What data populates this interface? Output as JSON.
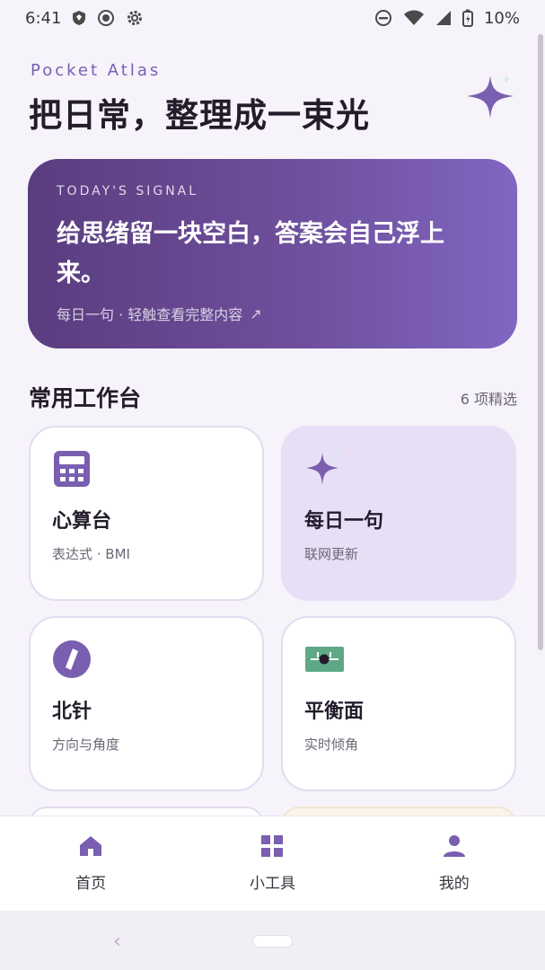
{
  "status_bar": {
    "time": "6:41",
    "battery": "10%",
    "left_icons": [
      "shield-icon",
      "record-icon",
      "gear-icon"
    ],
    "right_icons": [
      "dnd-icon",
      "wifi-icon",
      "signal-icon",
      "battery-icon"
    ]
  },
  "header": {
    "brand": "Pocket Atlas",
    "headline": "把日常，整理成一束光"
  },
  "signal_card": {
    "eyebrow": "TODAY'S SIGNAL",
    "quote": "给思绪留一块空白，答案会自己浮上来。",
    "meta": "每日一句 · 轻触查看完整内容",
    "arrow": "↗"
  },
  "section": {
    "title": "常用工作台",
    "count": "6 项精选"
  },
  "tools": [
    {
      "name": "心算台",
      "desc": "表达式 · BMI",
      "icon": "calculator-icon"
    },
    {
      "name": "每日一句",
      "desc": "联网更新",
      "icon": "sparkle-icon"
    },
    {
      "name": "北针",
      "desc": "方向与角度",
      "icon": "compass-icon"
    },
    {
      "name": "平衡面",
      "desc": "实时倾角",
      "icon": "level-icon"
    }
  ],
  "bottom_nav": [
    {
      "label": "首页",
      "icon": "home-icon"
    },
    {
      "label": "小工具",
      "icon": "grid-icon"
    },
    {
      "label": "我的",
      "icon": "person-icon"
    }
  ],
  "colors": {
    "accent": "#7a5fb0",
    "card_gradient_start": "#5a3d7f",
    "card_gradient_end": "#8166c2",
    "level_green": "#5fa886",
    "highlight_card": "#e7dff6"
  }
}
